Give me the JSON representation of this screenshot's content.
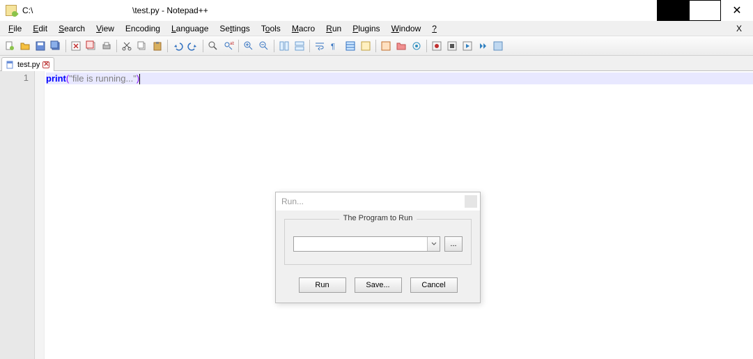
{
  "title": {
    "path": "C:\\",
    "file": "\\test.py - Notepad++"
  },
  "menu": [
    "File",
    "Edit",
    "Search",
    "View",
    "Encoding",
    "Language",
    "Settings",
    "Tools",
    "Macro",
    "Run",
    "Plugins",
    "Window",
    "?"
  ],
  "overflow": "X",
  "tab": {
    "name": "test.py"
  },
  "gutter_line": "1",
  "code": {
    "kw": "print",
    "open": "(",
    "str": "\"file is running...\"",
    "close": ")"
  },
  "dialog": {
    "title": "Run...",
    "legend": "The Program to Run",
    "combo_value": "",
    "browse": "...",
    "buttons": {
      "run": "Run",
      "save": "Save...",
      "cancel": "Cancel"
    }
  }
}
